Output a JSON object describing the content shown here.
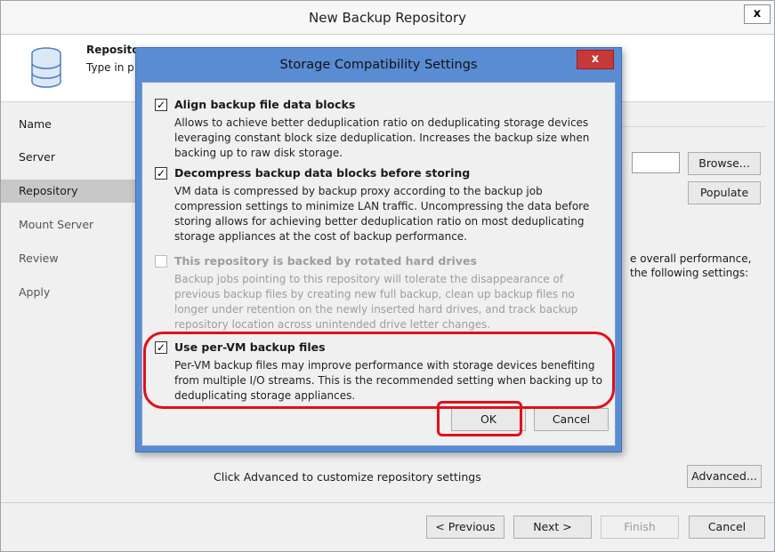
{
  "wizard": {
    "title": "New Backup Repository",
    "close_label": "x",
    "header": {
      "title": "Repository",
      "subtitle": "Type in p"
    },
    "nav": [
      {
        "label": "Name"
      },
      {
        "label": "Server"
      },
      {
        "label": "Repository"
      },
      {
        "label": "Mount Server"
      },
      {
        "label": "Review"
      },
      {
        "label": "Apply"
      }
    ],
    "active_nav": "Repository",
    "content": {
      "browse_label": "Browse...",
      "populate_label": "Populate",
      "side_text_1": "e overall performance,",
      "side_text_2": "the following settings:",
      "advanced_text": "Click Advanced to customize repository settings",
      "advanced_label": "Advanced..."
    },
    "footer": {
      "previous_label": "< Previous",
      "next_label": "Next >",
      "finish_label": "Finish",
      "cancel_label": "Cancel"
    }
  },
  "dialog": {
    "title": "Storage Compatibility Settings",
    "close_label": "x",
    "options": [
      {
        "label": "Align backup file data blocks",
        "checked": true,
        "enabled": true,
        "description": "Allows to achieve better deduplication ratio on deduplicating storage devices leveraging constant block size deduplication. Increases the backup size when backing up to raw disk storage."
      },
      {
        "label": "Decompress backup data blocks before storing",
        "checked": true,
        "enabled": true,
        "description": "VM data is compressed by backup proxy according to the backup job compression settings to minimize LAN traffic. Uncompressing the data before storing allows for achieving better deduplication ratio on most deduplicating storage appliances at the cost of backup performance."
      },
      {
        "label": "This repository is backed by rotated hard drives",
        "checked": false,
        "enabled": false,
        "description": "Backup jobs pointing to this repository will tolerate the disappearance of previous backup files by creating new full backup, clean up backup files no longer under retention on the newly inserted hard drives, and track backup repository location across unintended drive letter changes."
      },
      {
        "label": "Use per-VM backup files",
        "checked": true,
        "enabled": true,
        "description": "Per-VM backup files may improve performance with storage devices benefiting from multiple I/O streams. This is the recommended setting when backing up to deduplicating storage appliances."
      }
    ],
    "ok_label": "OK",
    "cancel_label": "Cancel"
  },
  "colors": {
    "dialog_frame": "#5a8cd3",
    "close_button": "#c73838",
    "annotation_red": "#e0101a",
    "nav_active": "#c8c8c8"
  }
}
